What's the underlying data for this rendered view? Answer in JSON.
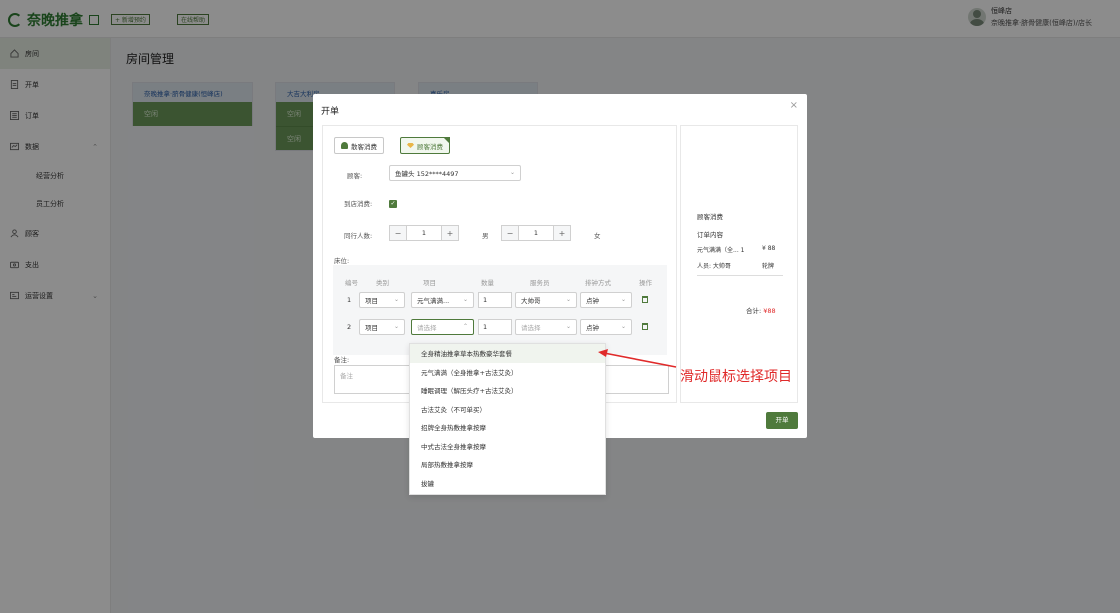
{
  "header": {
    "logo_text": "奈晚推拿",
    "btn_new_notice": "+ 新增预约",
    "btn_online_help": "在线帮助",
    "user_name": "恒峰店",
    "user_role": "奈晚推拿·脐骨健康(恒峰店)/店长"
  },
  "sidebar": {
    "items": [
      {
        "label": "房间",
        "icon": "home-icon"
      },
      {
        "label": "开单",
        "icon": "document-icon"
      },
      {
        "label": "订单",
        "icon": "list-icon"
      },
      {
        "label": "数据",
        "icon": "chart-icon"
      },
      {
        "label": "顾客",
        "icon": "user-icon"
      },
      {
        "label": "支出",
        "icon": "wallet-icon"
      },
      {
        "label": "运营设置",
        "icon": "settings-icon"
      }
    ],
    "sub_items": [
      "经营分析",
      "员工分析"
    ]
  },
  "main": {
    "page_title": "房间管理",
    "rooms": [
      {
        "title": "奈晚推拿·脐骨健康(恒峰店)",
        "status": "空闲"
      },
      {
        "title": "大吉大利房",
        "status": "空闲",
        "status2": "空闲"
      },
      {
        "title": "喜乐房",
        "status": ""
      }
    ]
  },
  "modal": {
    "title": "开单",
    "close": "×",
    "tab_guest": "散客消费",
    "tab_member": "顾客消费",
    "label_customer": "顾客:",
    "customer_value": "鱼罐头 152****4497",
    "label_arrive": "到店消费:",
    "label_companions": "同行人数:",
    "male_count": "1",
    "male_label": "男",
    "female_count": "1",
    "female_label": "女",
    "label_bed": "床位:",
    "table_headers": [
      "编号",
      "类别",
      "项目",
      "数量",
      "服务员",
      "排钟方式",
      "操作"
    ],
    "rows": [
      {
        "no": "1",
        "category": "项目",
        "item": "元气满满...",
        "qty": "1",
        "staff": "大帅哥",
        "mode": "点钟"
      },
      {
        "no": "2",
        "category": "项目",
        "item": "请选择",
        "qty": "1",
        "staff": "请选择",
        "mode": "点钟"
      }
    ],
    "label_note": "备注:",
    "note_placeholder": "备注",
    "submit": "开单"
  },
  "order_panel": {
    "section": "顾客消费",
    "content_title": "订单内容",
    "line_item": "元气满满（全... 1",
    "line_price": "¥ 88",
    "staff_label": "人员: 大帅哥",
    "staff_mode": "轮牌",
    "total_label": "合计:",
    "total_value": "¥88"
  },
  "dropdown": {
    "options": [
      "全身精油推拿草本热敷豪华套餐",
      "元气满满（全身推拿+古法艾灸）",
      "睡眠调理（解压头疗+古法艾灸）",
      "古法艾灸（不可单买）",
      "招牌全身热敷推拿按摩",
      "中式古法全身推拿按摩",
      "局部热敷推拿按摩",
      "拔罐"
    ]
  },
  "annotation": {
    "text": "滑动鼠标选择项目",
    "color": "#e02a2a"
  },
  "colors": {
    "brand": "#4f7a3c",
    "accent_price": "#e02a2a"
  }
}
